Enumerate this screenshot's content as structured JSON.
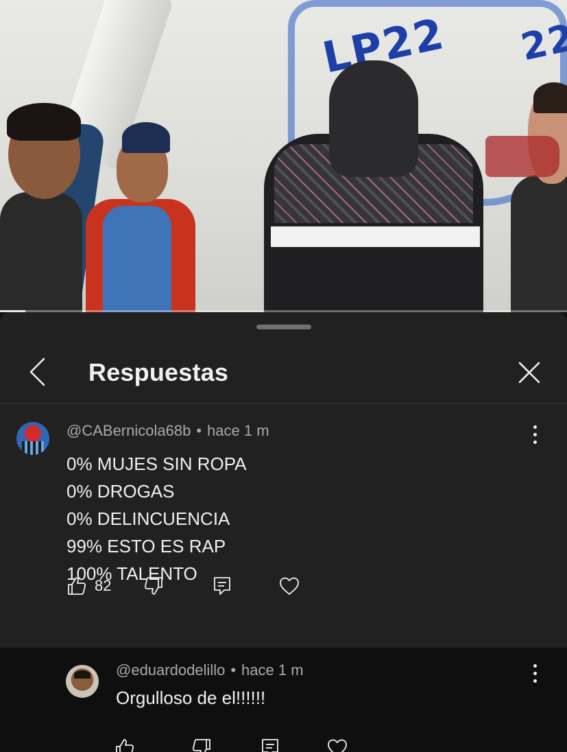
{
  "video": {
    "progress_fraction": 0.045,
    "wall_text_1": "LP22",
    "wall_text_2": "22"
  },
  "panel": {
    "title": "Respuestas",
    "back_icon": "chevron-left-icon",
    "close_icon": "close-icon"
  },
  "comments": [
    {
      "author": "@CABernicola68b",
      "separator": "•",
      "time": "hace 1 m",
      "lines": [
        "0% MUJES SIN ROPA",
        "0% DROGAS",
        "0% DELINCUENCIA",
        "99% ESTO ES RAP",
        "100% TALENTO"
      ],
      "likes": "82"
    },
    {
      "author": "@eduardodelillo",
      "separator": "•",
      "time": "hace 1 m",
      "text": "Orgulloso de el!!!!!!"
    }
  ],
  "colors": {
    "panel_bg": "#212121",
    "reply_bg": "#0f0f0f",
    "text_primary": "#f1f1f1",
    "text_secondary": "#aaaaaa"
  }
}
